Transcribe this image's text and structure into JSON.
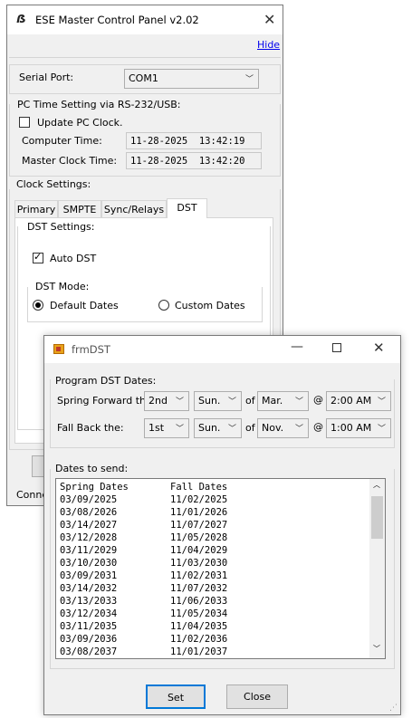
{
  "main_window": {
    "title": "ESE Master Control Panel v2.02",
    "hide_link": "Hide",
    "serial_port": {
      "label": "Serial Port:",
      "value": "COM1"
    },
    "pc_time": {
      "group_title": "PC Time Setting via RS-232/USB:",
      "update_checkbox_label": "Update PC Clock.",
      "computer_time_label": "Computer Time:",
      "computer_time_value": "11-28-2025  13:42:19",
      "master_clock_label": "Master Clock Time:",
      "master_clock_value": "11-28-2025  13:42:20"
    },
    "clock_settings": {
      "title": "Clock Settings:",
      "tabs": [
        {
          "label": "Primary"
        },
        {
          "label": "SMPTE"
        },
        {
          "label": "Sync/Relays"
        },
        {
          "label": "DST",
          "active": true
        }
      ],
      "dst_settings_title": "DST Settings:",
      "auto_dst_label": "Auto DST",
      "auto_dst_checked": true,
      "dst_mode_title": "DST Mode:",
      "default_dates_label": "Default Dates",
      "custom_dates_label": "Custom Dates",
      "selected_mode": "Default Dates"
    },
    "status_text": "Conne"
  },
  "dst_window": {
    "title": "frmDST",
    "program_group_title": "Program DST Dates:",
    "spring": {
      "label": "Spring Forward the:",
      "week": "2nd",
      "day": "Sun.",
      "of": "of",
      "month": "Mar.",
      "at": "@",
      "time": "2:00 AM"
    },
    "fall": {
      "label": "Fall Back the:",
      "week": "1st",
      "day": "Sun.",
      "of": "of",
      "month": "Nov.",
      "at": "@",
      "time": "1:00 AM"
    },
    "dates_group_title": "Dates to send:",
    "list_header": {
      "spring": "Spring Dates",
      "fall": "Fall Dates"
    },
    "dates": [
      {
        "spring": "03/09/2025",
        "fall": "11/02/2025"
      },
      {
        "spring": "03/08/2026",
        "fall": "11/01/2026"
      },
      {
        "spring": "03/14/2027",
        "fall": "11/07/2027"
      },
      {
        "spring": "03/12/2028",
        "fall": "11/05/2028"
      },
      {
        "spring": "03/11/2029",
        "fall": "11/04/2029"
      },
      {
        "spring": "03/10/2030",
        "fall": "11/03/2030"
      },
      {
        "spring": "03/09/2031",
        "fall": "11/02/2031"
      },
      {
        "spring": "03/14/2032",
        "fall": "11/07/2032"
      },
      {
        "spring": "03/13/2033",
        "fall": "11/06/2033"
      },
      {
        "spring": "03/12/2034",
        "fall": "11/05/2034"
      },
      {
        "spring": "03/11/2035",
        "fall": "11/04/2035"
      },
      {
        "spring": "03/09/2036",
        "fall": "11/02/2036"
      },
      {
        "spring": "03/08/2037",
        "fall": "11/01/2037"
      }
    ],
    "set_button": "Set",
    "close_button": "Close"
  },
  "icons": {
    "app_icon": "ese-logo-icon",
    "dst_icon": "form-icon",
    "close": "close-icon",
    "minimize": "minimize-icon",
    "maximize": "maximize-icon",
    "dropdown": "chevron-down-icon",
    "check": "check-icon"
  },
  "colors": {
    "window_bg": "#f0f0f0",
    "link": "#0000ee",
    "focus_border": "#0078d7",
    "app_icon_gold": "#e8a21a"
  }
}
